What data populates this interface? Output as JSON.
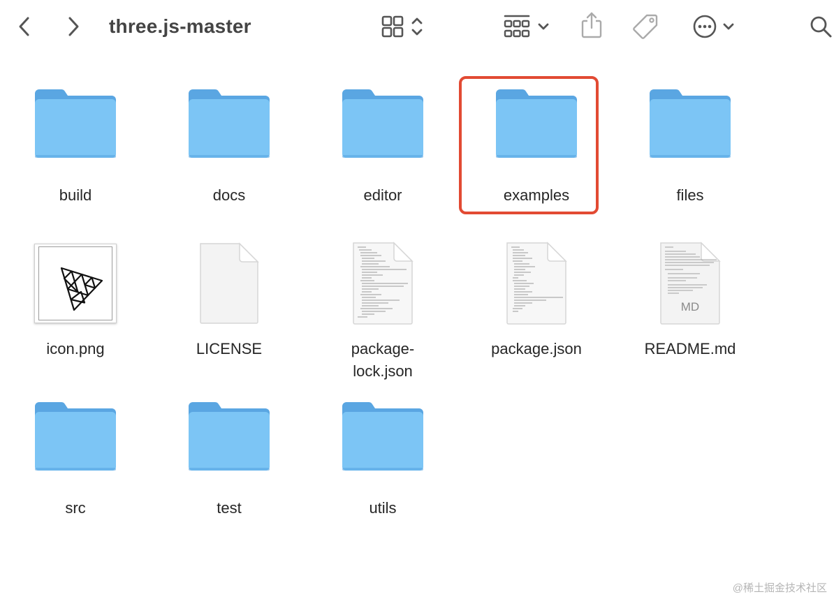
{
  "window": {
    "title": "three.js-master"
  },
  "toolbar": {
    "back_icon": "chevron-left-icon",
    "forward_icon": "chevron-right-icon",
    "view_icon": "icon-grid-view-icon",
    "group_icon": "group-by-icon",
    "share_icon": "share-icon",
    "tag_icon": "tag-icon",
    "more_icon": "ellipsis-circle-icon",
    "search_icon": "search-icon"
  },
  "colors": {
    "folder_front": "#7cc5f5",
    "folder_back": "#5aa6e2",
    "highlight": "#e24a33"
  },
  "items": [
    {
      "name": "build",
      "kind": "folder"
    },
    {
      "name": "docs",
      "kind": "folder"
    },
    {
      "name": "editor",
      "kind": "folder"
    },
    {
      "name": "examples",
      "kind": "folder",
      "highlighted": true
    },
    {
      "name": "files",
      "kind": "folder"
    },
    {
      "name": "icon.png",
      "kind": "image"
    },
    {
      "name": "LICENSE",
      "kind": "blank-document"
    },
    {
      "name": "package-\nlock.json",
      "kind": "text-document"
    },
    {
      "name": "package.json",
      "kind": "text-document"
    },
    {
      "name": "README.md",
      "kind": "markdown-document",
      "badge": "MD"
    },
    {
      "name": "src",
      "kind": "folder"
    },
    {
      "name": "test",
      "kind": "folder"
    },
    {
      "name": "utils",
      "kind": "folder"
    }
  ],
  "watermark": "@稀土掘金技术社区"
}
